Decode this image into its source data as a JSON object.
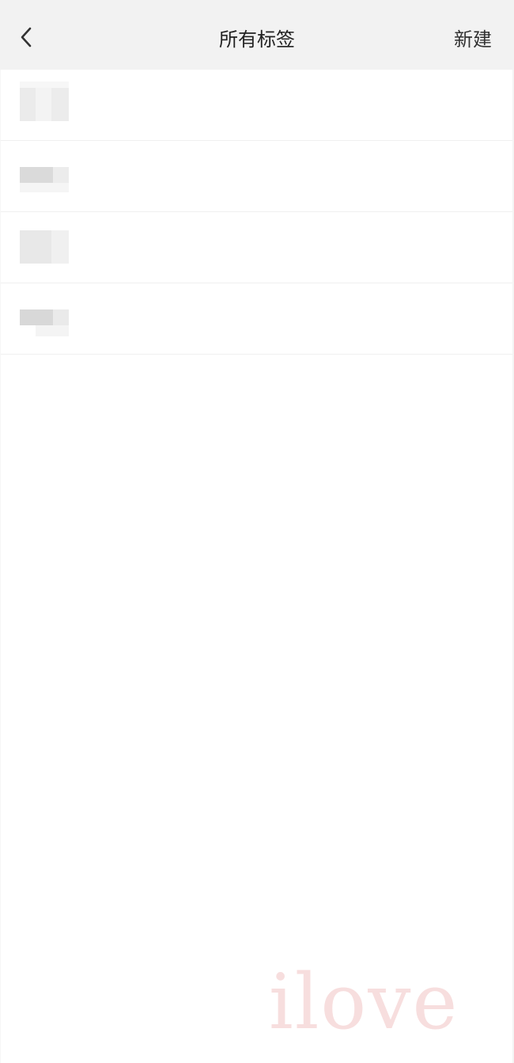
{
  "nav": {
    "title": "所有标签",
    "new_label": "新建",
    "back_icon": "chevron-left-icon"
  },
  "tags": [
    {
      "label": "",
      "blurred": true
    },
    {
      "label": "",
      "blurred": true
    },
    {
      "label": "",
      "blurred": true
    },
    {
      "label": "",
      "blurred": true
    }
  ],
  "watermark": "ilove",
  "colors": {
    "nav_background": "#f2f2f2",
    "page_background": "#ffffff",
    "divider": "#f0f0f0",
    "watermark": "#f7dede"
  }
}
